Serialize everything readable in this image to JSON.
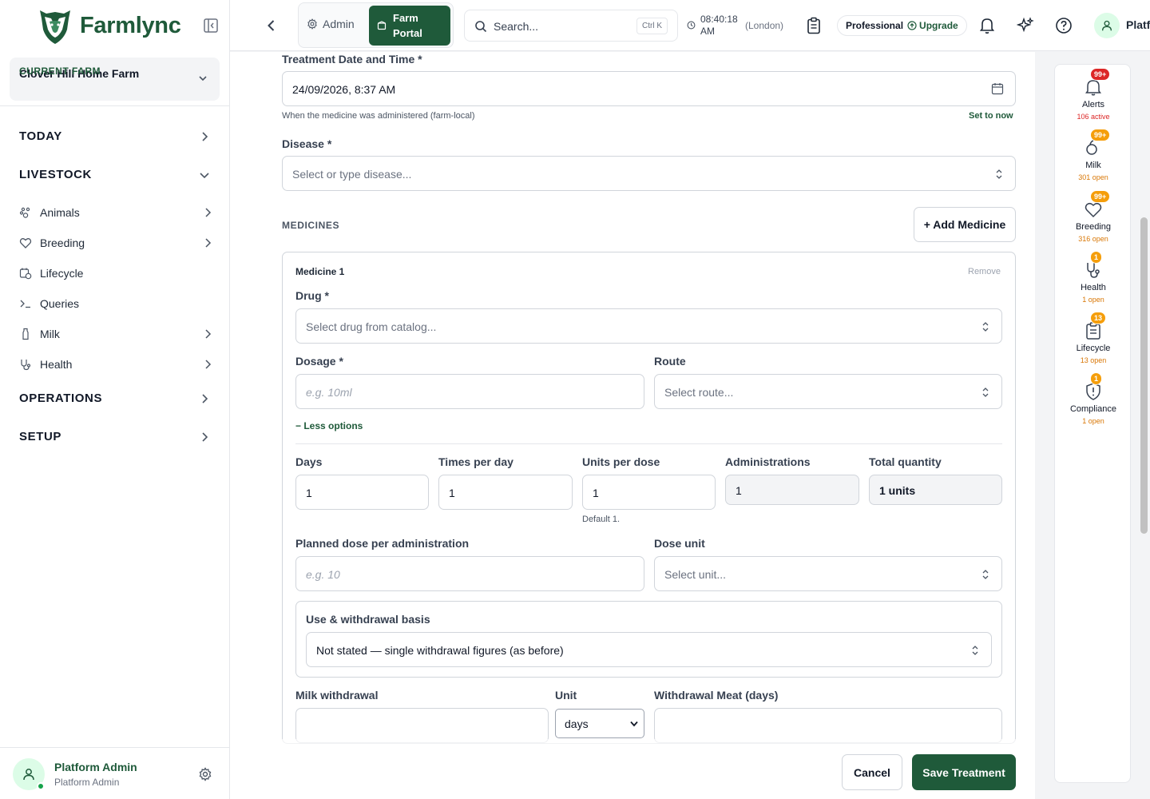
{
  "app": {
    "brand": "Farmlync",
    "brand_color": "#1f5a3a"
  },
  "sidebar": {
    "current_farm_label": "CURRENT FARM",
    "current_farm_value": "Clover Hill Home Farm",
    "sections": [
      {
        "label": "TODAY",
        "expanded": false
      },
      {
        "label": "LIVESTOCK",
        "expanded": true
      },
      {
        "label": "OPERATIONS",
        "expanded": false
      },
      {
        "label": "SETUP",
        "expanded": false
      }
    ],
    "livestock_items": [
      {
        "label": "Animals",
        "icon": "paw-icon",
        "has_children": true
      },
      {
        "label": "Breeding",
        "icon": "heart-icon",
        "has_children": true
      },
      {
        "label": "Lifecycle",
        "icon": "calendar-clock-icon",
        "has_children": false
      },
      {
        "label": "Queries",
        "icon": "terminal-icon",
        "has_children": false
      },
      {
        "label": "Milk",
        "icon": "milk-bottle-icon",
        "has_children": true
      },
      {
        "label": "Health",
        "icon": "stethoscope-icon",
        "has_children": true
      }
    ],
    "user": {
      "name": "Platform Admin",
      "role": "Platform Admin"
    }
  },
  "header": {
    "admin_label": "Admin",
    "farm_portal_line1": "Farm",
    "farm_portal_line2": "Portal",
    "search_placeholder": "Search...",
    "search_shortcut": "Ctrl K",
    "time_line1": "08:40:18",
    "time_line2": "AM",
    "timezone": "(London)",
    "plan": "Professional",
    "upgrade": "Upgrade",
    "user_name": "Platf"
  },
  "form": {
    "treatment_date_label": "Treatment Date and Time *",
    "treatment_date_value": "24/09/2026, 8:37 AM",
    "treatment_date_help": "When the medicine was administered (farm-local)",
    "set_to_now": "Set to now",
    "disease_label": "Disease *",
    "disease_placeholder": "Select or type disease...",
    "medicines_title": "MEDICINES",
    "add_medicine": "+ Add Medicine",
    "medicine": {
      "title": "Medicine 1",
      "remove": "Remove",
      "drug_label": "Drug *",
      "drug_placeholder": "Select drug from catalog...",
      "dosage_label": "Dosage *",
      "dosage_placeholder": "e.g. 10ml",
      "route_label": "Route",
      "route_placeholder": "Select route...",
      "less_options": "− Less options",
      "days_label": "Days",
      "days_value": "1",
      "times_label": "Times per day",
      "times_value": "1",
      "units_label": "Units per dose",
      "units_value": "1",
      "units_help": "Default 1.",
      "admins_label": "Administrations",
      "admins_value": "1",
      "total_label": "Total quantity",
      "total_value": "1 units",
      "planned_label": "Planned dose per administration",
      "planned_placeholder": "e.g. 10",
      "dose_unit_label": "Dose unit",
      "dose_unit_placeholder": "Select unit...",
      "basis_label": "Use & withdrawal basis",
      "basis_value": "Not stated — single withdrawal figures (as before)",
      "milk_withdrawal_label": "Milk withdrawal",
      "milk_withdrawal_value": "",
      "unit_label": "Unit",
      "unit_value": "days",
      "meat_withdrawal_label": "Withdrawal Meat (days)",
      "meat_withdrawal_value": ""
    },
    "cancel": "Cancel",
    "save": "Save Treatment"
  },
  "rail": [
    {
      "name": "Alerts",
      "badge": "99+",
      "badge_color": "#dc2626",
      "count": "106 active",
      "count_color": "#dc2626",
      "icon": "bell-icon"
    },
    {
      "name": "Milk",
      "badge": "99+",
      "badge_color": "#f59e0b",
      "count": "301 open",
      "count_color": "#d97706",
      "icon": "milk-drop-icon"
    },
    {
      "name": "Breeding",
      "badge": "99+",
      "badge_color": "#f59e0b",
      "count": "316 open",
      "count_color": "#d97706",
      "icon": "heart-icon"
    },
    {
      "name": "Health",
      "badge": "1",
      "badge_color": "#f59e0b",
      "count": "1 open",
      "count_color": "#d97706",
      "icon": "stethoscope-icon"
    },
    {
      "name": "Lifecycle",
      "badge": "13",
      "badge_color": "#f59e0b",
      "count": "13 open",
      "count_color": "#d97706",
      "icon": "clipboard-icon"
    },
    {
      "name": "Compliance",
      "badge": "1",
      "badge_color": "#f59e0b",
      "count": "1 open",
      "count_color": "#d97706",
      "icon": "shield-alert-icon"
    }
  ]
}
